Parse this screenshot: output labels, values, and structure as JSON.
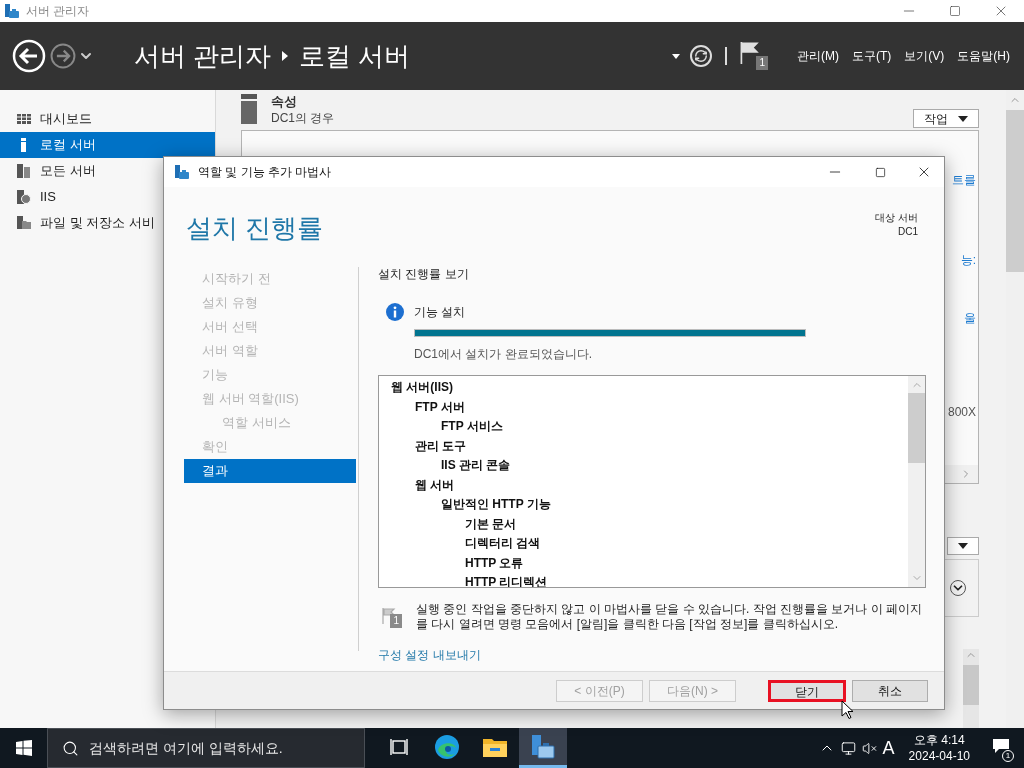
{
  "window": {
    "title": "서버 관리자"
  },
  "header": {
    "breadcrumb": [
      "서버 관리자",
      "로컬 서버"
    ],
    "flag_count": "1",
    "menus": [
      "관리(M)",
      "도구(T)",
      "보기(V)",
      "도움말(H)"
    ]
  },
  "sidebar": {
    "items": [
      {
        "label": "대시보드",
        "selected": false
      },
      {
        "label": "로컬 서버",
        "selected": true
      },
      {
        "label": "모든 서버",
        "selected": false
      },
      {
        "label": "IIS",
        "selected": false
      },
      {
        "label": "파일 및 저장소 서비",
        "selected": false
      }
    ]
  },
  "properties": {
    "title": "속성",
    "subtitle": "DC1의 경우",
    "tasks_button": "작업",
    "fragments": [
      "트를",
      "능:",
      "울",
      "800X"
    ]
  },
  "dialog": {
    "title": "역할 및 기능 추가 마법사",
    "heading": "설치 진행률",
    "target_label": "대상 서버",
    "target_server": "DC1",
    "nav": [
      {
        "label": "시작하기 전",
        "selected": false
      },
      {
        "label": "설치 유형",
        "selected": false
      },
      {
        "label": "서버 선택",
        "selected": false
      },
      {
        "label": "서버 역할",
        "selected": false
      },
      {
        "label": "기능",
        "selected": false
      },
      {
        "label": "웹 서버 역할(IIS)",
        "selected": false,
        "children": [
          {
            "label": "역할 서비스",
            "selected": false
          }
        ]
      },
      {
        "label": "확인",
        "selected": false
      },
      {
        "label": "결과",
        "selected": true
      }
    ],
    "section_title": "설치 진행률 보기",
    "task_label": "기능 설치",
    "progress": {
      "level": 1.0
    },
    "status": "DC1에서 설치가 완료되었습니다.",
    "installed": [
      {
        "label": "웹 서버(IIS)",
        "children": [
          {
            "label": "FTP 서버",
            "children": [
              {
                "label": "FTP 서비스"
              }
            ]
          },
          {
            "label": "관리 도구",
            "children": [
              {
                "label": "IIS 관리 콘솔"
              }
            ]
          },
          {
            "label": "웹 서버",
            "children": [
              {
                "label": "일반적인 HTTP 기능",
                "children": [
                  {
                    "label": "기본 문서"
                  },
                  {
                    "label": "디렉터리 검색"
                  },
                  {
                    "label": "HTTP 오류"
                  },
                  {
                    "label": "HTTP 리디렉션"
                  }
                ]
              }
            ]
          }
        ]
      }
    ],
    "note_badge": "1",
    "note": "실행 중인 작업을 중단하지 않고 이 마법사를 닫을 수 있습니다. 작업 진행률을 보거나 이 페이지를 다시 열려면 명령 모음에서 [알림]을 클릭한 다음 [작업 정보]를 클릭하십시오.",
    "export_link": "구성 설정 내보내기",
    "buttons": [
      {
        "label": "< 이전(P)",
        "disabled": true,
        "highlighted": false
      },
      {
        "label": "다음(N) >",
        "disabled": true,
        "highlighted": false
      },
      {
        "label": "닫기",
        "disabled": false,
        "highlighted": true
      },
      {
        "label": "취소",
        "disabled": false,
        "highlighted": false
      }
    ]
  },
  "taskbar": {
    "search_placeholder": "검색하려면 여기에 입력하세요.",
    "apps": [
      {
        "selected": false
      },
      {
        "selected": false
      },
      {
        "selected": false
      },
      {
        "selected": true
      }
    ],
    "ime": "A",
    "time": "오후 4:14",
    "date": "2024-04-10",
    "notification_count": "1"
  }
}
